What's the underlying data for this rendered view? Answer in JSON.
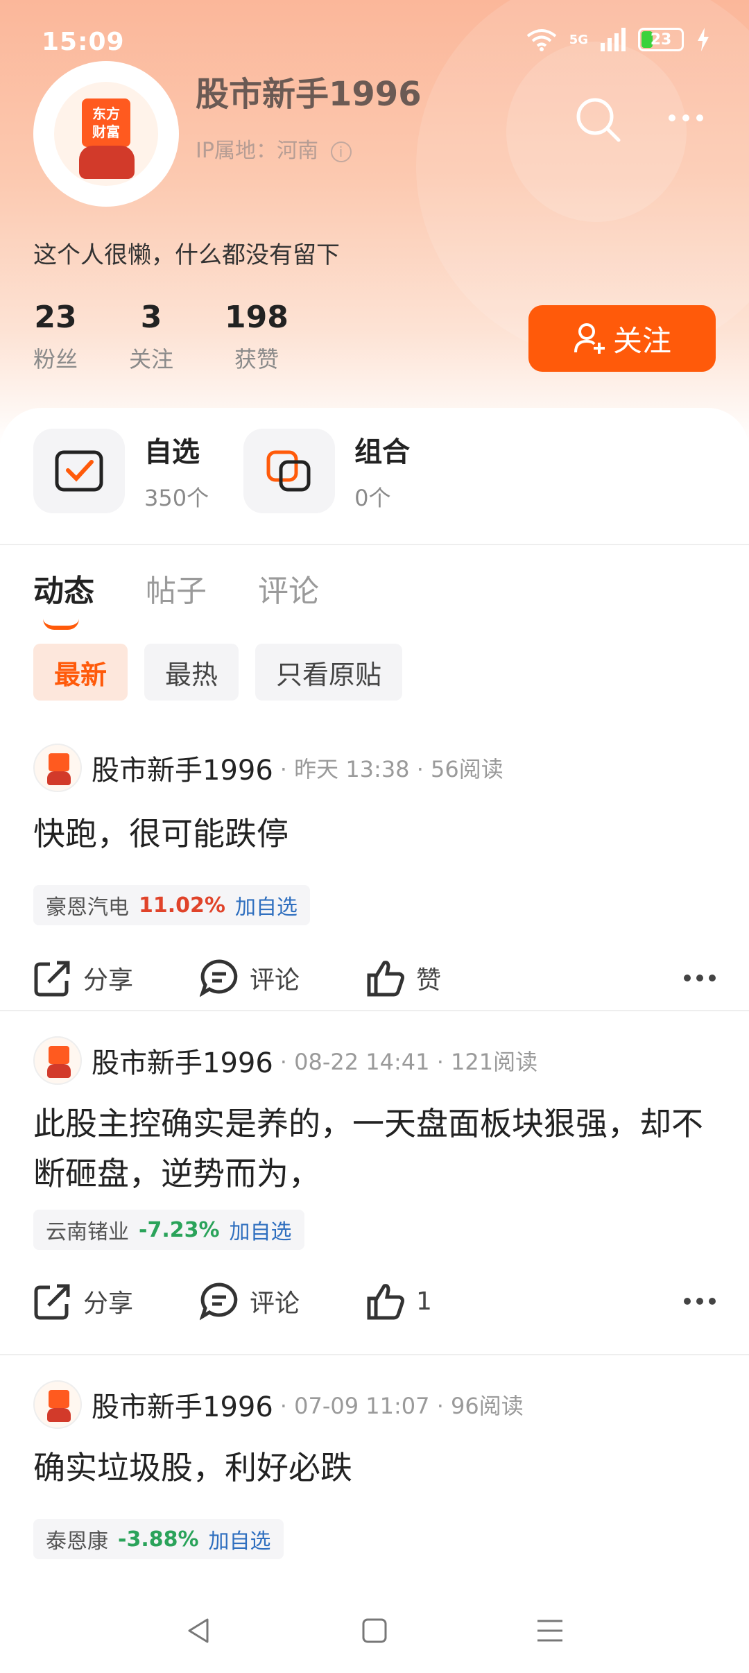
{
  "status_bar": {
    "time": "15:09",
    "network": "5G",
    "battery": "23"
  },
  "profile": {
    "name": "股市新手1996",
    "ip_location": "IP属地：河南",
    "avatar_text_line1": "东方",
    "avatar_text_line2": "财富",
    "bio": "这个人很懒，什么都没有留下",
    "stats": [
      {
        "value": "23",
        "label": "粉丝"
      },
      {
        "value": "3",
        "label": "关注"
      },
      {
        "value": "198",
        "label": "获赞"
      }
    ],
    "follow_label": "关注"
  },
  "quick": {
    "watchlist": {
      "title": "自选",
      "count": "350个"
    },
    "portfolio": {
      "title": "组合",
      "count": "0个"
    }
  },
  "tabs": [
    "动态",
    "帖子",
    "评论"
  ],
  "filters": [
    "最新",
    "最热",
    "只看原贴"
  ],
  "posts": [
    {
      "author": "股市新手1996",
      "meta": "· 昨天 13:38 · 56阅读",
      "text": "快跑，很可能跌停",
      "stock_name": "豪恩汽电",
      "stock_change": "11.02%",
      "add_label": "加自选",
      "share_label": "分享",
      "comment_label": "评论",
      "like_label": "赞"
    },
    {
      "author": "股市新手1996",
      "meta": "· 08-22 14:41 · 121阅读",
      "text": "此股主控确实是养的，一天盘面板块狠强，却不断砸盘，逆势而为，",
      "stock_name": "云南锗业",
      "stock_change": "-7.23%",
      "add_label": "加自选",
      "share_label": "分享",
      "comment_label": "评论",
      "like_label": "1"
    },
    {
      "author": "股市新手1996",
      "meta": "· 07-09 11:07 · 96阅读",
      "text": "确实垃圾股，利好必跌",
      "stock_name": "泰恩康",
      "stock_change": "-3.88%",
      "add_label": "加自选"
    }
  ],
  "colors": {
    "accent": "#ff5a0a",
    "up": "#e0432a",
    "down": "#2aa35a",
    "link": "#2f6fbf"
  }
}
